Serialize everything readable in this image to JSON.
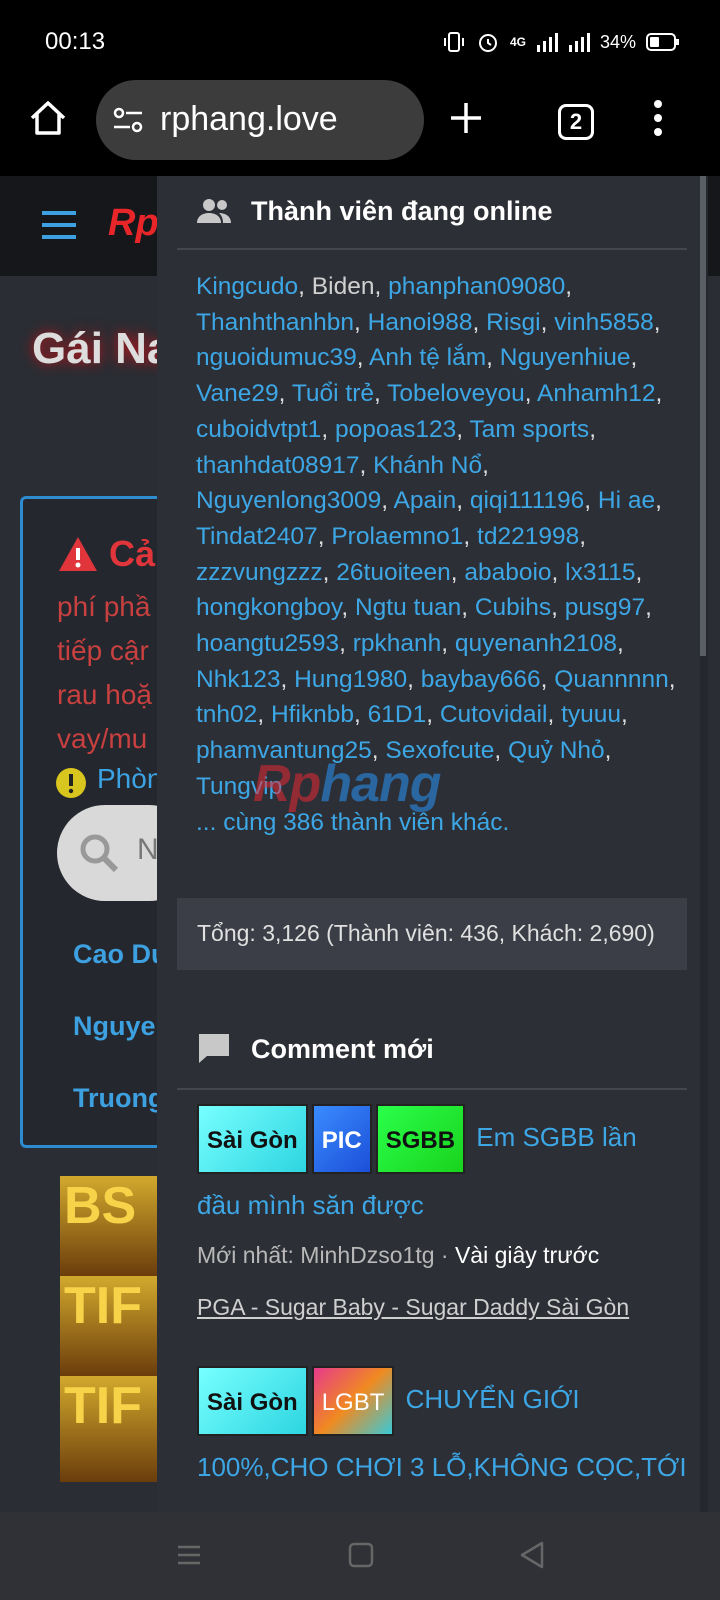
{
  "status": {
    "time": "00:13",
    "network": "4G",
    "battery": "34%"
  },
  "browser": {
    "url": "rphang.love",
    "tab_count": "2"
  },
  "background": {
    "logo": "Rp",
    "title": "Gái Na",
    "notice_head": "Cả",
    "notice_lines": [
      "phí phầ",
      "tiếp cậr",
      "rau hoặ",
      "vay/mu"
    ],
    "phong": "Phòn",
    "search_letter": "N",
    "links": [
      "Cao Du",
      "Nguye",
      "Truong"
    ],
    "thumbs": [
      "BS",
      "TIF",
      "TIF"
    ]
  },
  "online": {
    "title": "Thành viên đang online",
    "members": [
      "Kingcudo",
      "Biden",
      "phanphan09080",
      "Thanhthanhbn",
      "Hanoi988",
      "Risgi",
      "vinh5858",
      "nguoidumuc39",
      "Anh tệ lắm",
      "Nguyenhiue",
      "Vane29",
      "Tuổi trẻ",
      "Tobeloveyou",
      "Anhamh12",
      "cuboidvtpt1",
      "popoas123",
      "Tam sports",
      "thanhdat08917",
      "Khánh Nổ",
      "Nguyenlong3009",
      "Apain",
      "qiqi111196",
      "Hi ae",
      "Tindat2407",
      "Prolaemno1",
      "td221998",
      "zzzvungzzz",
      "26tuoiteen",
      "ababoio",
      "lx3115",
      "hongkongboy",
      "Ngtu tuan",
      "Cubihs",
      "pusg97",
      "hoangtu2593",
      "rpkhanh",
      "quyenanh2108",
      "Nhk123",
      "Hung1980",
      "baybay666",
      "Quannnnn",
      "tnh02",
      "Hfiknbb",
      "61D1",
      "Cutovidail",
      "tyuuu",
      "phamvantung25",
      "Sexofcute",
      "Quỷ Nhỏ",
      "Tungvip"
    ],
    "more": "... cùng 386 thành viên khác.",
    "totals": "Tổng: 3,126 (Thành viên: 436, Khách: 2,690)"
  },
  "comments": {
    "title": "Comment mới",
    "items": [
      {
        "tags": [
          "Sài Gòn",
          "PIC",
          "SGBB"
        ],
        "title": "Em SGBB lần đầu mình săn được",
        "meta_prefix": "Mới nhất: MinhDzso1tg · ",
        "meta_time": "Vài giây trước",
        "forum": "PGA - Sugar Baby - Sugar Daddy Sài Gòn"
      },
      {
        "tags": [
          "Sài Gòn",
          "LGBT"
        ],
        "title": "CHUYỂN GIỚI 100%,CHO CHƠI 3 LỖ,KHÔNG CỌC,TỚI"
      }
    ]
  },
  "watermark": {
    "part1": "Rp",
    "part2": "hang"
  },
  "colors": {
    "link": "#3da7e6",
    "panel": "#2d2f36",
    "accent_red": "#e0353a"
  }
}
